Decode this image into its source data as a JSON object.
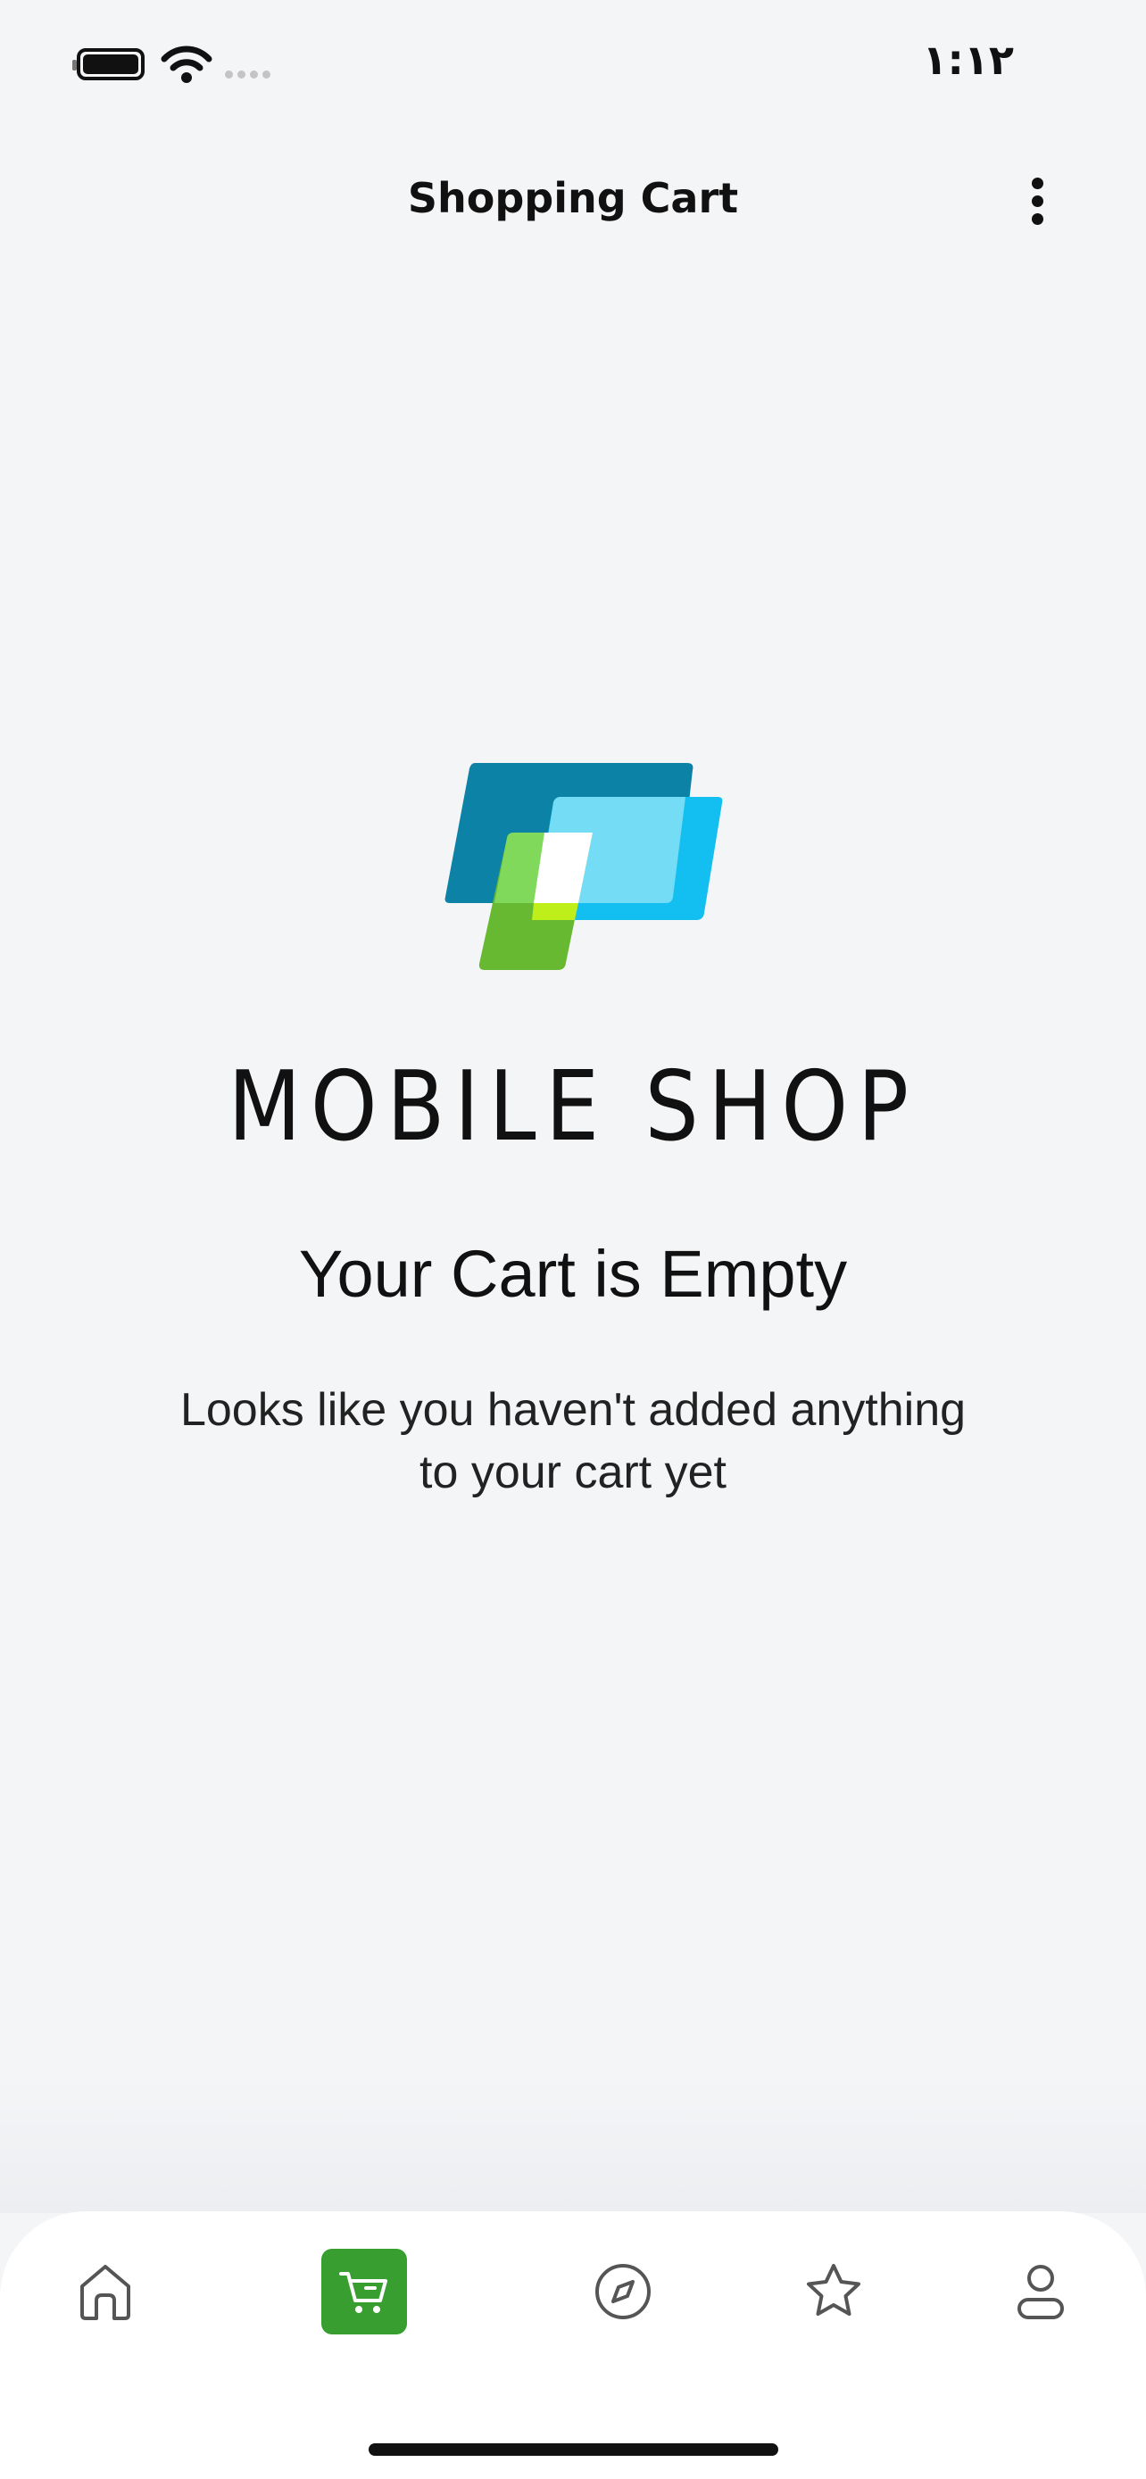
{
  "status_bar": {
    "time": "۱:۱۲",
    "icons": [
      "battery-icon",
      "wifi-icon",
      "cellular-signal-icon"
    ]
  },
  "header": {
    "title": "Shopping Cart",
    "menu_icon": "more-vertical-icon"
  },
  "brand": {
    "name": "MOBILE SHOP",
    "colors": {
      "dark_blue": "#0b82a6",
      "light_blue": "#13bff0",
      "pale_blue": "#75dcf6",
      "green": "#67b931",
      "light_green": "#80d95b",
      "lime": "#bfef1a"
    }
  },
  "empty_state": {
    "title": "Your Cart is Empty",
    "message": "Looks like you haven't added anything to your cart yet"
  },
  "bottom_nav": {
    "active_color": "#389e2f",
    "items": [
      {
        "icon": "home-icon",
        "active": false
      },
      {
        "icon": "cart-icon",
        "active": true
      },
      {
        "icon": "compass-icon",
        "active": false
      },
      {
        "icon": "star-icon",
        "active": false
      },
      {
        "icon": "profile-icon",
        "active": false
      }
    ]
  }
}
